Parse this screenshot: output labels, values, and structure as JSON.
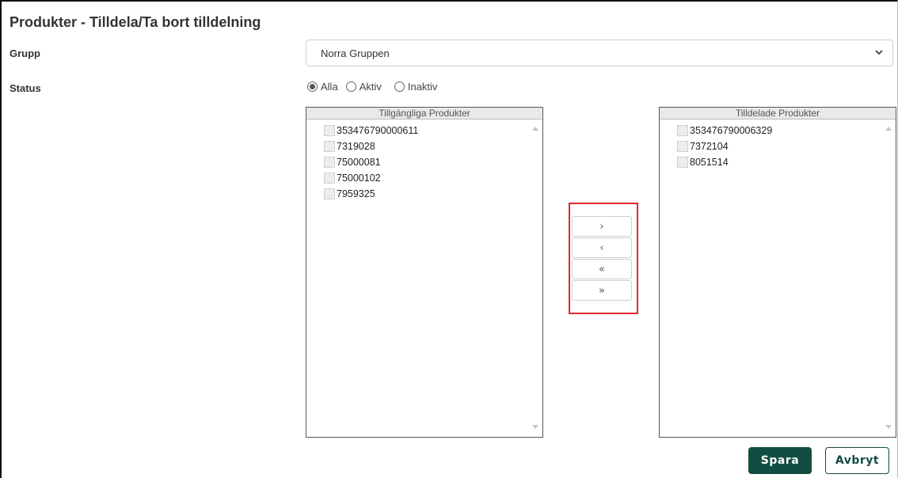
{
  "page": {
    "title": "Produkter - Tilldela/Ta bort tilldelning"
  },
  "form": {
    "group_label": "Grupp",
    "group_value": "Norra Gruppen",
    "status_label": "Status",
    "status_options": [
      {
        "label": "Alla",
        "checked": true
      },
      {
        "label": "Aktiv",
        "checked": false
      },
      {
        "label": "Inaktiv",
        "checked": false
      }
    ]
  },
  "available": {
    "header": "Tillgängliga Produkter",
    "items": [
      "353476790000611",
      "7319028",
      "75000081",
      "75000102",
      "7959325"
    ]
  },
  "assigned": {
    "header": "Tilldelade Produkter",
    "items": [
      "353476790006329",
      "7372104",
      "8051514"
    ]
  },
  "move_buttons": {
    "move_selected_right": "›",
    "move_selected_left": "‹",
    "move_all_left": "«",
    "move_all_right": "»"
  },
  "actions": {
    "save_label": "Spara",
    "cancel_label": "Avbryt"
  },
  "colors": {
    "primary": "#124d43",
    "highlight": "#e3262e"
  },
  "icons": {
    "select_chevron": "chevron-down-icon"
  }
}
